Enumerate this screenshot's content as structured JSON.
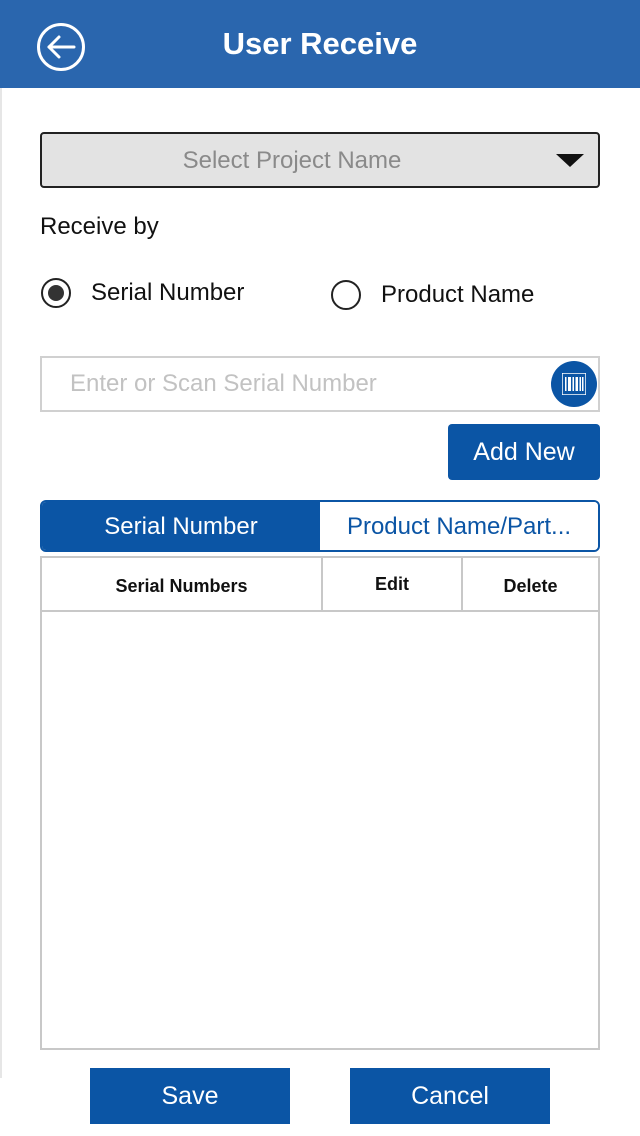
{
  "header": {
    "title": "User Receive",
    "back_icon": "back-arrow-circle-icon",
    "color": "#2a66ae"
  },
  "project_select": {
    "placeholder": "Select Project Name",
    "icon": "caret-down-icon"
  },
  "receive_by": {
    "label": "Receive by",
    "options": [
      {
        "label": "Serial Number",
        "selected": true
      },
      {
        "label": "Product Name",
        "selected": false
      }
    ]
  },
  "serial_input": {
    "placeholder": "Enter or Scan Serial Number",
    "value": "",
    "scan_icon": "barcode-icon"
  },
  "add_button": {
    "label": "Add New"
  },
  "segment": {
    "tabs": [
      {
        "label": "Serial Number",
        "active": true
      },
      {
        "label": "Product Name/Part...",
        "active": false
      }
    ]
  },
  "table": {
    "columns": [
      "Serial Numbers",
      "Edit",
      "Delete"
    ],
    "rows": []
  },
  "footer": {
    "save_label": "Save",
    "cancel_label": "Cancel"
  },
  "colors": {
    "primary": "#0b55a5",
    "header": "#2a66ae"
  }
}
